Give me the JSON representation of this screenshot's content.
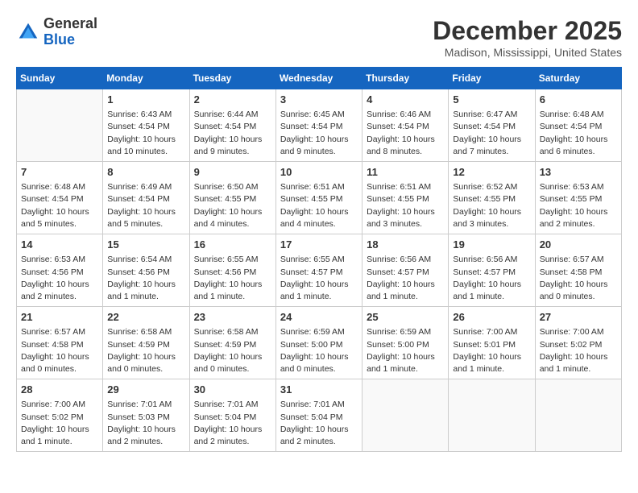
{
  "header": {
    "logo": {
      "line1": "General",
      "line2": "Blue"
    },
    "title": "December 2025",
    "location": "Madison, Mississippi, United States"
  },
  "weekdays": [
    "Sunday",
    "Monday",
    "Tuesday",
    "Wednesday",
    "Thursday",
    "Friday",
    "Saturday"
  ],
  "weeks": [
    [
      {
        "day": "",
        "info": ""
      },
      {
        "day": "1",
        "info": "Sunrise: 6:43 AM\nSunset: 4:54 PM\nDaylight: 10 hours\nand 10 minutes."
      },
      {
        "day": "2",
        "info": "Sunrise: 6:44 AM\nSunset: 4:54 PM\nDaylight: 10 hours\nand 9 minutes."
      },
      {
        "day": "3",
        "info": "Sunrise: 6:45 AM\nSunset: 4:54 PM\nDaylight: 10 hours\nand 9 minutes."
      },
      {
        "day": "4",
        "info": "Sunrise: 6:46 AM\nSunset: 4:54 PM\nDaylight: 10 hours\nand 8 minutes."
      },
      {
        "day": "5",
        "info": "Sunrise: 6:47 AM\nSunset: 4:54 PM\nDaylight: 10 hours\nand 7 minutes."
      },
      {
        "day": "6",
        "info": "Sunrise: 6:48 AM\nSunset: 4:54 PM\nDaylight: 10 hours\nand 6 minutes."
      }
    ],
    [
      {
        "day": "7",
        "info": "Sunrise: 6:48 AM\nSunset: 4:54 PM\nDaylight: 10 hours\nand 5 minutes."
      },
      {
        "day": "8",
        "info": "Sunrise: 6:49 AM\nSunset: 4:54 PM\nDaylight: 10 hours\nand 5 minutes."
      },
      {
        "day": "9",
        "info": "Sunrise: 6:50 AM\nSunset: 4:55 PM\nDaylight: 10 hours\nand 4 minutes."
      },
      {
        "day": "10",
        "info": "Sunrise: 6:51 AM\nSunset: 4:55 PM\nDaylight: 10 hours\nand 4 minutes."
      },
      {
        "day": "11",
        "info": "Sunrise: 6:51 AM\nSunset: 4:55 PM\nDaylight: 10 hours\nand 3 minutes."
      },
      {
        "day": "12",
        "info": "Sunrise: 6:52 AM\nSunset: 4:55 PM\nDaylight: 10 hours\nand 3 minutes."
      },
      {
        "day": "13",
        "info": "Sunrise: 6:53 AM\nSunset: 4:55 PM\nDaylight: 10 hours\nand 2 minutes."
      }
    ],
    [
      {
        "day": "14",
        "info": "Sunrise: 6:53 AM\nSunset: 4:56 PM\nDaylight: 10 hours\nand 2 minutes."
      },
      {
        "day": "15",
        "info": "Sunrise: 6:54 AM\nSunset: 4:56 PM\nDaylight: 10 hours\nand 1 minute."
      },
      {
        "day": "16",
        "info": "Sunrise: 6:55 AM\nSunset: 4:56 PM\nDaylight: 10 hours\nand 1 minute."
      },
      {
        "day": "17",
        "info": "Sunrise: 6:55 AM\nSunset: 4:57 PM\nDaylight: 10 hours\nand 1 minute."
      },
      {
        "day": "18",
        "info": "Sunrise: 6:56 AM\nSunset: 4:57 PM\nDaylight: 10 hours\nand 1 minute."
      },
      {
        "day": "19",
        "info": "Sunrise: 6:56 AM\nSunset: 4:57 PM\nDaylight: 10 hours\nand 1 minute."
      },
      {
        "day": "20",
        "info": "Sunrise: 6:57 AM\nSunset: 4:58 PM\nDaylight: 10 hours\nand 0 minutes."
      }
    ],
    [
      {
        "day": "21",
        "info": "Sunrise: 6:57 AM\nSunset: 4:58 PM\nDaylight: 10 hours\nand 0 minutes."
      },
      {
        "day": "22",
        "info": "Sunrise: 6:58 AM\nSunset: 4:59 PM\nDaylight: 10 hours\nand 0 minutes."
      },
      {
        "day": "23",
        "info": "Sunrise: 6:58 AM\nSunset: 4:59 PM\nDaylight: 10 hours\nand 0 minutes."
      },
      {
        "day": "24",
        "info": "Sunrise: 6:59 AM\nSunset: 5:00 PM\nDaylight: 10 hours\nand 0 minutes."
      },
      {
        "day": "25",
        "info": "Sunrise: 6:59 AM\nSunset: 5:00 PM\nDaylight: 10 hours\nand 1 minute."
      },
      {
        "day": "26",
        "info": "Sunrise: 7:00 AM\nSunset: 5:01 PM\nDaylight: 10 hours\nand 1 minute."
      },
      {
        "day": "27",
        "info": "Sunrise: 7:00 AM\nSunset: 5:02 PM\nDaylight: 10 hours\nand 1 minute."
      }
    ],
    [
      {
        "day": "28",
        "info": "Sunrise: 7:00 AM\nSunset: 5:02 PM\nDaylight: 10 hours\nand 1 minute."
      },
      {
        "day": "29",
        "info": "Sunrise: 7:01 AM\nSunset: 5:03 PM\nDaylight: 10 hours\nand 2 minutes."
      },
      {
        "day": "30",
        "info": "Sunrise: 7:01 AM\nSunset: 5:04 PM\nDaylight: 10 hours\nand 2 minutes."
      },
      {
        "day": "31",
        "info": "Sunrise: 7:01 AM\nSunset: 5:04 PM\nDaylight: 10 hours\nand 2 minutes."
      },
      {
        "day": "",
        "info": ""
      },
      {
        "day": "",
        "info": ""
      },
      {
        "day": "",
        "info": ""
      }
    ]
  ]
}
